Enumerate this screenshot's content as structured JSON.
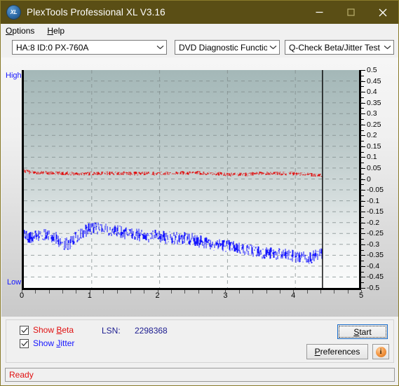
{
  "window": {
    "title": "PlexTools Professional XL V3.16",
    "icon": "XL",
    "minimize_label": "minimize",
    "maximize_label": "maximize",
    "close_label": "close",
    "titlebar_color": "#5a4e15"
  },
  "menu": {
    "items": [
      {
        "label": "Options",
        "accel": "O"
      },
      {
        "label": "Help",
        "accel": "H"
      }
    ]
  },
  "toolbar": {
    "selects": [
      {
        "name": "drive-select",
        "value": "HA:8 ID:0  PX-760A"
      },
      {
        "name": "function-group-select",
        "value": "DVD Diagnostic Functions"
      },
      {
        "name": "test-select",
        "value": "Q-Check Beta/Jitter Test"
      }
    ]
  },
  "chart_panel": {
    "axis_left_top_label": "High",
    "axis_left_bottom_label": "Low"
  },
  "controls": {
    "show_beta": {
      "label": "Show Beta",
      "accel": "B",
      "checked": true,
      "color": "#e01010"
    },
    "show_jitter": {
      "label": "Show Jitter",
      "accel": "J",
      "checked": true,
      "color": "#1414ff"
    },
    "lsn_label": "LSN:",
    "lsn_value": "2298368",
    "start_label": "Start",
    "start_accel": "S",
    "preferences_label": "Preferences",
    "preferences_accel": "P",
    "info_label": "i"
  },
  "statusbar": {
    "text": "Ready",
    "color": "#e01010"
  },
  "chart_data": {
    "type": "line",
    "title": "Q-Check Beta/Jitter Test",
    "xlabel": "",
    "ylabel": "",
    "xlim": [
      0,
      5
    ],
    "ylim": [
      -0.5,
      0.5
    ],
    "xticks": [
      0,
      1,
      2,
      3,
      4,
      5
    ],
    "yticks": [
      0.5,
      0.45,
      0.4,
      0.35,
      0.3,
      0.25,
      0.2,
      0.15,
      0.1,
      0.05,
      0,
      -0.05,
      -0.1,
      -0.15,
      -0.2,
      -0.25,
      -0.3,
      -0.35,
      -0.4,
      -0.45,
      -0.5
    ],
    "ytick_labels": [
      "0.5",
      "0.45",
      "0.4",
      "0.35",
      "0.3",
      "0.25",
      "0.2",
      "0.15",
      "0.1",
      "0.05",
      "0",
      "-0.05",
      "-0.1",
      "-0.15",
      "-0.2",
      "-0.25",
      "-0.3",
      "-0.35",
      "-0.4",
      "-0.45",
      "-0.5"
    ],
    "grid": true,
    "grid_style": "dashed",
    "grid_color": "#7f8a8a",
    "background_gradient": [
      "#a4b8b8",
      "#fcfcfc"
    ],
    "cursor_line_x": 4.4,
    "data_end_x": 4.4,
    "legend": [
      {
        "name": "Beta",
        "color": "#e01010"
      },
      {
        "name": "Jitter",
        "color": "#1414ff"
      }
    ],
    "series": [
      {
        "name": "Beta",
        "color": "#e01010",
        "band": true,
        "x": [
          0.0,
          0.05,
          0.1,
          0.15,
          0.2,
          0.25,
          0.3,
          0.35,
          0.4,
          0.45,
          0.5,
          0.55,
          0.6,
          0.65,
          0.7,
          0.75,
          0.8,
          0.85,
          0.9,
          0.95,
          1.0,
          1.05,
          1.1,
          1.15,
          1.2,
          1.25,
          1.3,
          1.35,
          1.4,
          1.45,
          1.5,
          1.55,
          1.6,
          1.65,
          1.7,
          1.75,
          1.8,
          1.85,
          1.9,
          1.95,
          2.0,
          2.05,
          2.1,
          2.15,
          2.2,
          2.25,
          2.3,
          2.35,
          2.4,
          2.45,
          2.5,
          2.55,
          2.6,
          2.65,
          2.7,
          2.75,
          2.8,
          2.85,
          2.9,
          2.95,
          3.0,
          3.05,
          3.1,
          3.15,
          3.2,
          3.25,
          3.3,
          3.35,
          3.4,
          3.45,
          3.5,
          3.55,
          3.6,
          3.65,
          3.7,
          3.75,
          3.8,
          3.85,
          3.9,
          3.95,
          4.0,
          4.05,
          4.1,
          4.15,
          4.2,
          4.25,
          4.3,
          4.35,
          4.4
        ],
        "values": [
          0.038,
          0.034,
          0.031,
          0.03,
          0.029,
          0.029,
          0.028,
          0.028,
          0.027,
          0.027,
          0.026,
          0.026,
          0.026,
          0.026,
          0.025,
          0.025,
          0.025,
          0.025,
          0.025,
          0.025,
          0.026,
          0.026,
          0.026,
          0.026,
          0.026,
          0.026,
          0.026,
          0.026,
          0.026,
          0.026,
          0.026,
          0.025,
          0.025,
          0.025,
          0.025,
          0.025,
          0.025,
          0.025,
          0.025,
          0.025,
          0.025,
          0.025,
          0.026,
          0.026,
          0.026,
          0.027,
          0.027,
          0.028,
          0.028,
          0.028,
          0.028,
          0.028,
          0.028,
          0.027,
          0.027,
          0.026,
          0.025,
          0.024,
          0.023,
          0.022,
          0.021,
          0.021,
          0.021,
          0.021,
          0.021,
          0.021,
          0.022,
          0.023,
          0.024,
          0.025,
          0.026,
          0.026,
          0.026,
          0.026,
          0.026,
          0.026,
          0.025,
          0.025,
          0.025,
          0.025,
          0.024,
          0.023,
          0.022,
          0.021,
          0.02,
          0.019,
          0.019,
          0.018,
          0.018
        ],
        "noise_amplitude": 0.009
      },
      {
        "name": "Jitter",
        "color": "#1414ff",
        "band": true,
        "x": [
          0.0,
          0.05,
          0.1,
          0.15,
          0.2,
          0.25,
          0.3,
          0.35,
          0.4,
          0.45,
          0.5,
          0.55,
          0.6,
          0.65,
          0.7,
          0.75,
          0.8,
          0.85,
          0.9,
          0.95,
          1.0,
          1.05,
          1.1,
          1.15,
          1.2,
          1.25,
          1.3,
          1.35,
          1.4,
          1.45,
          1.5,
          1.55,
          1.6,
          1.65,
          1.7,
          1.75,
          1.8,
          1.85,
          1.9,
          1.95,
          2.0,
          2.05,
          2.1,
          2.15,
          2.2,
          2.25,
          2.3,
          2.35,
          2.4,
          2.45,
          2.5,
          2.55,
          2.6,
          2.65,
          2.7,
          2.75,
          2.8,
          2.85,
          2.9,
          2.95,
          3.0,
          3.05,
          3.1,
          3.15,
          3.2,
          3.25,
          3.3,
          3.35,
          3.4,
          3.45,
          3.5,
          3.55,
          3.6,
          3.65,
          3.7,
          3.75,
          3.8,
          3.85,
          3.9,
          3.95,
          4.0,
          4.05,
          4.1,
          4.15,
          4.2,
          4.25,
          4.3,
          4.35,
          4.4
        ],
        "values": [
          -0.25,
          -0.265,
          -0.272,
          -0.268,
          -0.262,
          -0.258,
          -0.255,
          -0.258,
          -0.262,
          -0.268,
          -0.278,
          -0.29,
          -0.3,
          -0.298,
          -0.288,
          -0.272,
          -0.258,
          -0.246,
          -0.238,
          -0.232,
          -0.228,
          -0.226,
          -0.225,
          -0.226,
          -0.228,
          -0.231,
          -0.234,
          -0.238,
          -0.242,
          -0.246,
          -0.25,
          -0.253,
          -0.255,
          -0.257,
          -0.258,
          -0.259,
          -0.26,
          -0.261,
          -0.262,
          -0.263,
          -0.265,
          -0.266,
          -0.268,
          -0.269,
          -0.271,
          -0.272,
          -0.272,
          -0.272,
          -0.273,
          -0.275,
          -0.278,
          -0.282,
          -0.286,
          -0.29,
          -0.293,
          -0.296,
          -0.298,
          -0.3,
          -0.302,
          -0.304,
          -0.306,
          -0.309,
          -0.312,
          -0.315,
          -0.318,
          -0.321,
          -0.324,
          -0.327,
          -0.33,
          -0.333,
          -0.336,
          -0.338,
          -0.34,
          -0.342,
          -0.344,
          -0.346,
          -0.348,
          -0.35,
          -0.352,
          -0.354,
          -0.356,
          -0.358,
          -0.359,
          -0.36,
          -0.36,
          -0.358,
          -0.354,
          -0.348,
          -0.342
        ],
        "noise_amplitude": 0.03
      }
    ]
  }
}
